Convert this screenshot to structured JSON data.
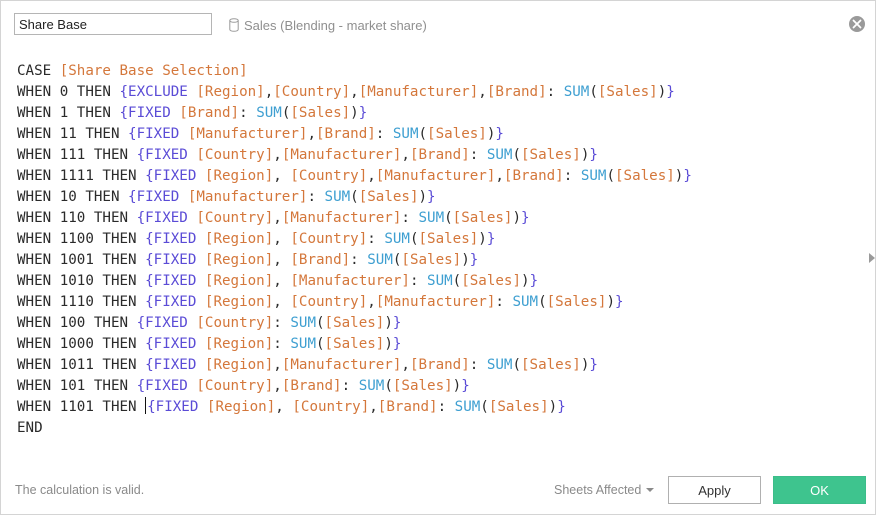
{
  "header": {
    "calc_name": "Share Base",
    "datasource_label": "Sales (Blending - market share)"
  },
  "icons": {
    "datasource": "database-icon",
    "close": "close-circle-icon",
    "scroll": "chevron-right-icon",
    "sheets_dropdown": "chevron-down-icon"
  },
  "colors": {
    "keyword": "#2a2a2a",
    "field": "#d4773b",
    "lod": "#5a4bd6",
    "function": "#3e9fd1",
    "ok_button": "#3ec48e"
  },
  "code": [
    [
      [
        "kw",
        "CASE "
      ],
      [
        "field",
        "[Share Base Selection]"
      ]
    ],
    [
      [
        "kw",
        "WHEN 0 THEN "
      ],
      [
        "lod",
        "{EXCLUDE "
      ],
      [
        "field",
        "[Region]"
      ],
      [
        "punct",
        ","
      ],
      [
        "field",
        "[Country]"
      ],
      [
        "punct",
        ","
      ],
      [
        "field",
        "[Manufacturer]"
      ],
      [
        "punct",
        ","
      ],
      [
        "field",
        "[Brand]"
      ],
      [
        "punct",
        ": "
      ],
      [
        "fn",
        "SUM"
      ],
      [
        "punct",
        "("
      ],
      [
        "field",
        "[Sales]"
      ],
      [
        "punct",
        ")"
      ],
      [
        "lod",
        "}"
      ]
    ],
    [
      [
        "kw",
        "WHEN 1 THEN "
      ],
      [
        "lod",
        "{FIXED "
      ],
      [
        "field",
        "[Brand]"
      ],
      [
        "punct",
        ": "
      ],
      [
        "fn",
        "SUM"
      ],
      [
        "punct",
        "("
      ],
      [
        "field",
        "[Sales]"
      ],
      [
        "punct",
        ")"
      ],
      [
        "lod",
        "}"
      ]
    ],
    [
      [
        "kw",
        "WHEN 11 THEN "
      ],
      [
        "lod",
        "{FIXED "
      ],
      [
        "field",
        "[Manufacturer]"
      ],
      [
        "punct",
        ","
      ],
      [
        "field",
        "[Brand]"
      ],
      [
        "punct",
        ": "
      ],
      [
        "fn",
        "SUM"
      ],
      [
        "punct",
        "("
      ],
      [
        "field",
        "[Sales]"
      ],
      [
        "punct",
        ")"
      ],
      [
        "lod",
        "}"
      ]
    ],
    [
      [
        "kw",
        "WHEN 111 THEN "
      ],
      [
        "lod",
        "{FIXED "
      ],
      [
        "field",
        "[Country]"
      ],
      [
        "punct",
        ","
      ],
      [
        "field",
        "[Manufacturer]"
      ],
      [
        "punct",
        ","
      ],
      [
        "field",
        "[Brand]"
      ],
      [
        "punct",
        ": "
      ],
      [
        "fn",
        "SUM"
      ],
      [
        "punct",
        "("
      ],
      [
        "field",
        "[Sales]"
      ],
      [
        "punct",
        ")"
      ],
      [
        "lod",
        "}"
      ]
    ],
    [
      [
        "kw",
        "WHEN 1111 THEN "
      ],
      [
        "lod",
        "{FIXED "
      ],
      [
        "field",
        "[Region]"
      ],
      [
        "punct",
        ", "
      ],
      [
        "field",
        "[Country]"
      ],
      [
        "punct",
        ","
      ],
      [
        "field",
        "[Manufacturer]"
      ],
      [
        "punct",
        ","
      ],
      [
        "field",
        "[Brand]"
      ],
      [
        "punct",
        ": "
      ],
      [
        "fn",
        "SUM"
      ],
      [
        "punct",
        "("
      ],
      [
        "field",
        "[Sales]"
      ],
      [
        "punct",
        ")"
      ],
      [
        "lod",
        "}"
      ]
    ],
    [
      [
        "kw",
        "WHEN 10 THEN "
      ],
      [
        "lod",
        "{FIXED "
      ],
      [
        "field",
        "[Manufacturer]"
      ],
      [
        "punct",
        ": "
      ],
      [
        "fn",
        "SUM"
      ],
      [
        "punct",
        "("
      ],
      [
        "field",
        "[Sales]"
      ],
      [
        "punct",
        ")"
      ],
      [
        "lod",
        "}"
      ]
    ],
    [
      [
        "kw",
        "WHEN 110 THEN "
      ],
      [
        "lod",
        "{FIXED "
      ],
      [
        "field",
        "[Country]"
      ],
      [
        "punct",
        ","
      ],
      [
        "field",
        "[Manufacturer]"
      ],
      [
        "punct",
        ": "
      ],
      [
        "fn",
        "SUM"
      ],
      [
        "punct",
        "("
      ],
      [
        "field",
        "[Sales]"
      ],
      [
        "punct",
        ")"
      ],
      [
        "lod",
        "}"
      ]
    ],
    [
      [
        "kw",
        "WHEN 1100 THEN "
      ],
      [
        "lod",
        "{FIXED "
      ],
      [
        "field",
        "[Region]"
      ],
      [
        "punct",
        ", "
      ],
      [
        "field",
        "[Country]"
      ],
      [
        "punct",
        ": "
      ],
      [
        "fn",
        "SUM"
      ],
      [
        "punct",
        "("
      ],
      [
        "field",
        "[Sales]"
      ],
      [
        "punct",
        ")"
      ],
      [
        "lod",
        "}"
      ]
    ],
    [
      [
        "kw",
        "WHEN 1001 THEN "
      ],
      [
        "lod",
        "{FIXED "
      ],
      [
        "field",
        "[Region]"
      ],
      [
        "punct",
        ", "
      ],
      [
        "field",
        "[Brand]"
      ],
      [
        "punct",
        ": "
      ],
      [
        "fn",
        "SUM"
      ],
      [
        "punct",
        "("
      ],
      [
        "field",
        "[Sales]"
      ],
      [
        "punct",
        ")"
      ],
      [
        "lod",
        "}"
      ]
    ],
    [
      [
        "kw",
        "WHEN 1010 THEN "
      ],
      [
        "lod",
        "{FIXED "
      ],
      [
        "field",
        "[Region]"
      ],
      [
        "punct",
        ", "
      ],
      [
        "field",
        "[Manufacturer]"
      ],
      [
        "punct",
        ": "
      ],
      [
        "fn",
        "SUM"
      ],
      [
        "punct",
        "("
      ],
      [
        "field",
        "[Sales]"
      ],
      [
        "punct",
        ")"
      ],
      [
        "lod",
        "}"
      ]
    ],
    [
      [
        "kw",
        "WHEN 1110 THEN "
      ],
      [
        "lod",
        "{FIXED "
      ],
      [
        "field",
        "[Region]"
      ],
      [
        "punct",
        ", "
      ],
      [
        "field",
        "[Country]"
      ],
      [
        "punct",
        ","
      ],
      [
        "field",
        "[Manufacturer]"
      ],
      [
        "punct",
        ": "
      ],
      [
        "fn",
        "SUM"
      ],
      [
        "punct",
        "("
      ],
      [
        "field",
        "[Sales]"
      ],
      [
        "punct",
        ")"
      ],
      [
        "lod",
        "}"
      ]
    ],
    [
      [
        "kw",
        "WHEN 100 THEN "
      ],
      [
        "lod",
        "{FIXED "
      ],
      [
        "field",
        "[Country]"
      ],
      [
        "punct",
        ": "
      ],
      [
        "fn",
        "SUM"
      ],
      [
        "punct",
        "("
      ],
      [
        "field",
        "[Sales]"
      ],
      [
        "punct",
        ")"
      ],
      [
        "lod",
        "}"
      ]
    ],
    [
      [
        "kw",
        "WHEN 1000 THEN "
      ],
      [
        "lod",
        "{FIXED "
      ],
      [
        "field",
        "[Region]"
      ],
      [
        "punct",
        ": "
      ],
      [
        "fn",
        "SUM"
      ],
      [
        "punct",
        "("
      ],
      [
        "field",
        "[Sales]"
      ],
      [
        "punct",
        ")"
      ],
      [
        "lod",
        "}"
      ]
    ],
    [
      [
        "kw",
        "WHEN 1011 THEN "
      ],
      [
        "lod",
        "{FIXED "
      ],
      [
        "field",
        "[Region]"
      ],
      [
        "punct",
        ","
      ],
      [
        "field",
        "[Manufacturer]"
      ],
      [
        "punct",
        ","
      ],
      [
        "field",
        "[Brand]"
      ],
      [
        "punct",
        ": "
      ],
      [
        "fn",
        "SUM"
      ],
      [
        "punct",
        "("
      ],
      [
        "field",
        "[Sales]"
      ],
      [
        "punct",
        ")"
      ],
      [
        "lod",
        "}"
      ]
    ],
    [
      [
        "kw",
        "WHEN 101 THEN "
      ],
      [
        "lod",
        "{FIXED "
      ],
      [
        "field",
        "[Country]"
      ],
      [
        "punct",
        ","
      ],
      [
        "field",
        "[Brand]"
      ],
      [
        "punct",
        ": "
      ],
      [
        "fn",
        "SUM"
      ],
      [
        "punct",
        "("
      ],
      [
        "field",
        "[Sales]"
      ],
      [
        "punct",
        ")"
      ],
      [
        "lod",
        "}"
      ]
    ],
    [
      [
        "kw",
        "WHEN 1101 THEN "
      ],
      [
        "caret",
        ""
      ],
      [
        "lod",
        "{FIXED "
      ],
      [
        "field",
        "[Region]"
      ],
      [
        "punct",
        ", "
      ],
      [
        "field",
        "[Country]"
      ],
      [
        "punct",
        ","
      ],
      [
        "field",
        "[Brand]"
      ],
      [
        "punct",
        ": "
      ],
      [
        "fn",
        "SUM"
      ],
      [
        "punct",
        "("
      ],
      [
        "field",
        "[Sales]"
      ],
      [
        "punct",
        ")"
      ],
      [
        "lod",
        "}"
      ]
    ],
    [
      [
        "kw",
        "END"
      ]
    ]
  ],
  "footer": {
    "status": "The calculation is valid.",
    "sheets_affected": "Sheets Affected",
    "apply_label": "Apply",
    "ok_label": "OK"
  }
}
